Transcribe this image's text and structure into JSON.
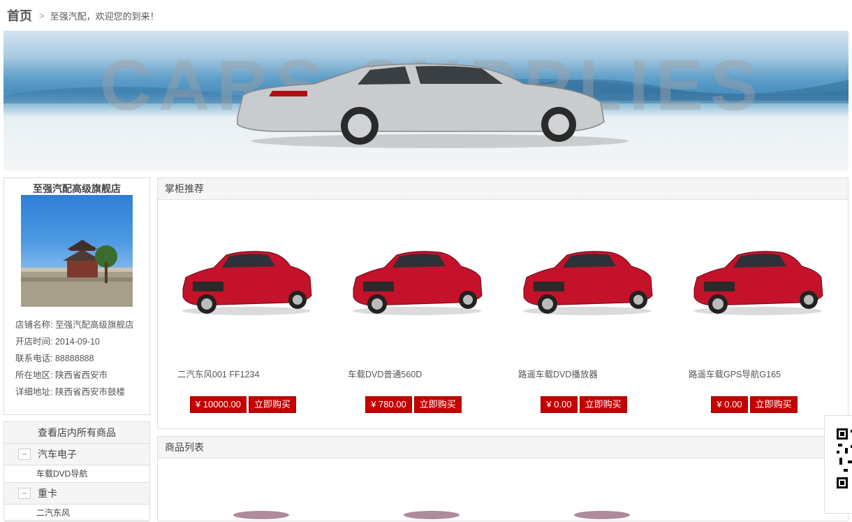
{
  "breadcrumb": {
    "home": "首页",
    "separator": ">",
    "welcome": "至强汽配，欢迎您的到来！"
  },
  "banner": {
    "text": "CARS SUPPLIES"
  },
  "shop": {
    "title": "至强汽配高级旗舰店",
    "info": [
      "店铺名称: 至强汽配高级旗舰店",
      "开店时间: 2014-09-10",
      "联系电话: 88888888",
      "所在地区: 陕西省西安市",
      "详细地址: 陕西省西安市鼓楼"
    ]
  },
  "categories": {
    "header": "查看店内所有商品",
    "groups": [
      {
        "name": "汽车电子",
        "toggle": "−",
        "items": [
          "车载DVD导航"
        ]
      },
      {
        "name": "重卡",
        "toggle": "−",
        "items": [
          "二汽东风"
        ]
      }
    ]
  },
  "recommend": {
    "title": "掌柜推荐",
    "products": [
      {
        "name": "二汽东风001 FF1234",
        "price": "¥ 10000.00",
        "buy": "立即购买"
      },
      {
        "name": "车载DVD普通560D",
        "price": "¥ 780.00",
        "buy": "立即购买"
      },
      {
        "name": "路遥车载DVD播放器",
        "price": "¥ 0.00",
        "buy": "立即购买"
      },
      {
        "name": "路遥车载GPS导航G165",
        "price": "¥ 0.00",
        "buy": "立即购买"
      }
    ]
  },
  "product_list": {
    "title": "商品列表"
  },
  "colors": {
    "accent_red": "#c40000"
  }
}
